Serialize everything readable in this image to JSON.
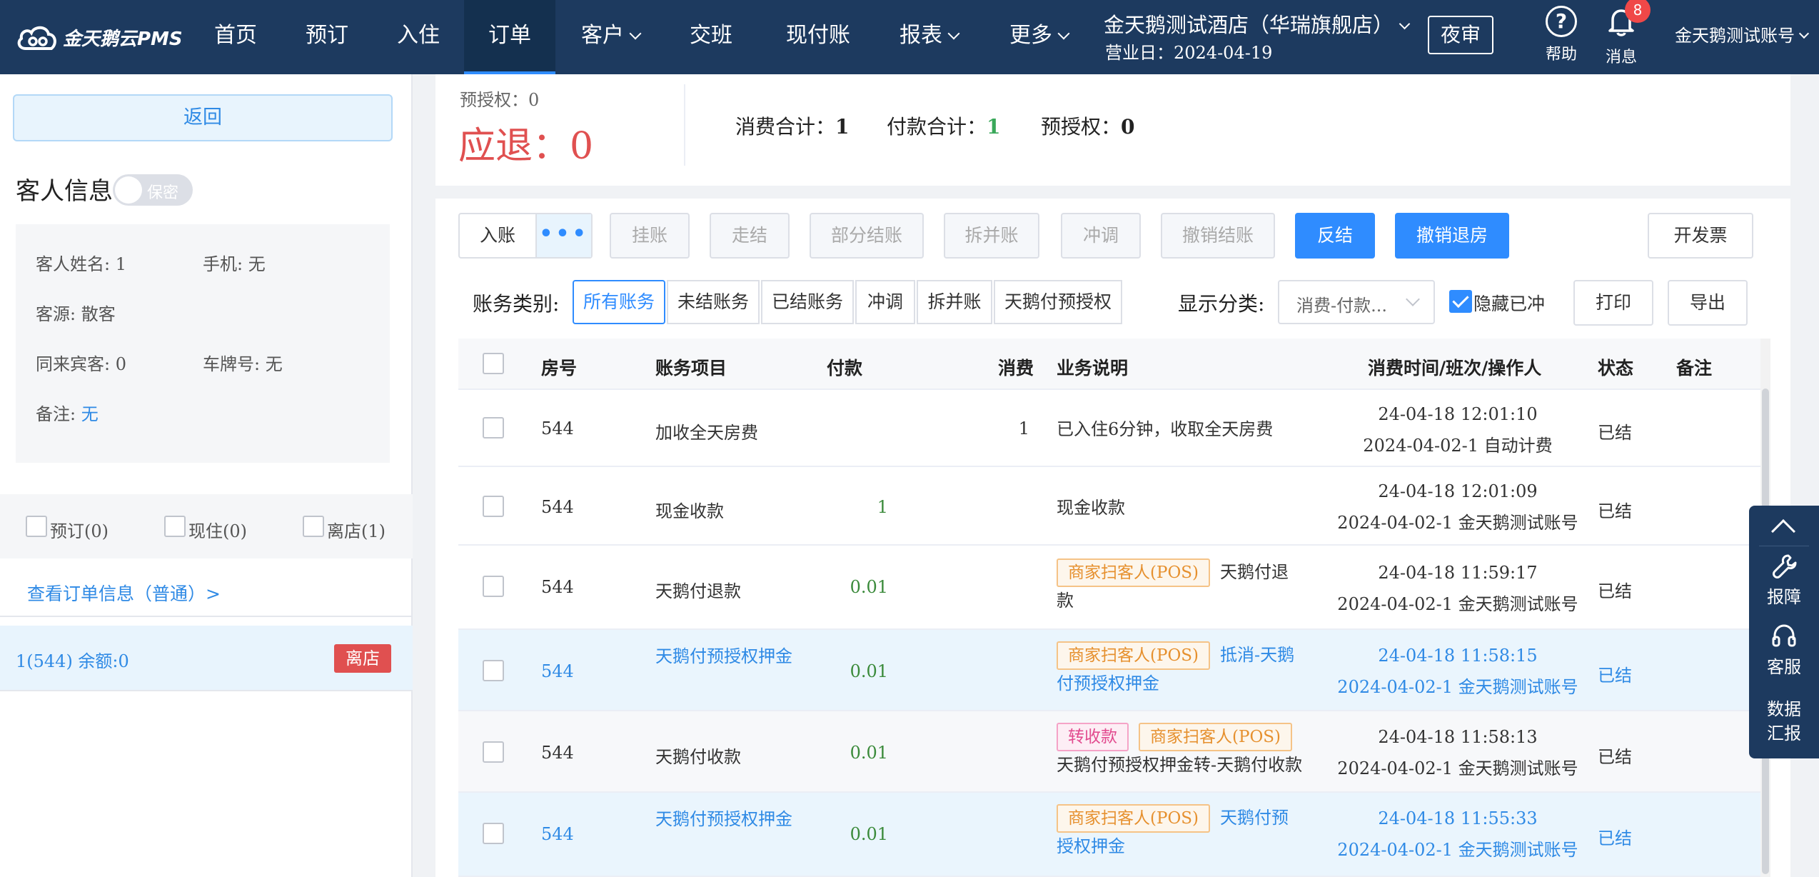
{
  "nav": {
    "logo_text": "金天鹅云PMS",
    "items": [
      {
        "label": "首页",
        "dropdown": false,
        "active": false
      },
      {
        "label": "预订",
        "dropdown": false,
        "active": false
      },
      {
        "label": "入住",
        "dropdown": false,
        "active": false
      },
      {
        "label": "订单",
        "dropdown": false,
        "active": true
      },
      {
        "label": "客户",
        "dropdown": true,
        "active": false
      },
      {
        "label": "交班",
        "dropdown": false,
        "active": false
      },
      {
        "label": "现付账",
        "dropdown": false,
        "active": false
      },
      {
        "label": "报表",
        "dropdown": true,
        "active": false
      },
      {
        "label": "更多",
        "dropdown": true,
        "active": false
      }
    ],
    "hotel_name": "金天鹅测试酒店（华瑞旗舰店）",
    "business_date": "营业日：2024-04-19",
    "night_audit": "夜审",
    "help_label": "帮助",
    "message_label": "消息",
    "message_count": "8",
    "account": "金天鹅测试账号"
  },
  "sidebar": {
    "back": "返回",
    "guest_title": "客人信息",
    "privacy": "保密",
    "guest": {
      "name": "客人姓名: 1",
      "phone": "手机: 无",
      "source": "客源: 散客",
      "companions": "同来宾客: 0",
      "plate": "车牌号: 无",
      "remark_label": "备注: ",
      "remark_value": "无"
    },
    "filters": [
      {
        "label": "预订(0)"
      },
      {
        "label": "现住(0)"
      },
      {
        "label": "离店(1)"
      }
    ],
    "view_order": "查看订单信息（普通）>",
    "room": {
      "text": "1(544)   余额:0",
      "status": "离店"
    }
  },
  "summary": {
    "pre_auth_small": "预授权：0",
    "refund": "应退：0",
    "consume_label": "消费合计：",
    "consume_value": "1",
    "payment_label": "付款合计：",
    "payment_value": "1",
    "pre_auth_label": "预授权：",
    "pre_auth_value": "0"
  },
  "toolbar": {
    "post": "入账",
    "more": "•••",
    "hang": "挂账",
    "walk": "走结",
    "partial": "部分结账",
    "split_merge": "拆并账",
    "adjust": "冲调",
    "cancel_checkout": "撤销结账",
    "reverse": "反结",
    "undo_checkout_room": "撤销退房",
    "invoice": "开发票"
  },
  "filters": {
    "category_label": "账务类别:",
    "tabs": [
      "所有账务",
      "未结账务",
      "已结账务",
      "冲调",
      "拆并账",
      "天鹅付预授权"
    ],
    "display_label": "显示分类:",
    "display_value": "消费-付款...",
    "hide_adjusted": "隐藏已冲调账",
    "print": "打印",
    "export": "导出"
  },
  "table": {
    "headers": {
      "room": "房号",
      "item": "账务项目",
      "payment": "付款",
      "consume": "消费",
      "desc": "业务说明",
      "time": "消费时间/班次/操作人",
      "status": "状态",
      "remark": "备注"
    },
    "rows": [
      {
        "room": "544",
        "item": "加收全天房费",
        "payment": "",
        "consume": "1",
        "tags": [],
        "desc": "已入住6分钟，收取全天房费",
        "time": "24-04-18 12:01:10",
        "shift": "2024-04-02-1 自动计费",
        "status": "已结"
      },
      {
        "room": "544",
        "item": "现金收款",
        "payment": "1",
        "consume": "",
        "tags": [],
        "desc": "现金收款",
        "time": "24-04-18 12:01:09",
        "shift": "2024-04-02-1 金天鹅测试账号",
        "status": "已结"
      },
      {
        "room": "544",
        "item": "天鹅付退款",
        "payment": "0.01",
        "consume": "",
        "tags": [
          "商家扫客人(POS)"
        ],
        "desc": "天鹅付退款",
        "time": "24-04-18 11:59:17",
        "shift": "2024-04-02-1 金天鹅测试账号",
        "status": "已结"
      },
      {
        "room": "544",
        "item": "天鹅付预授权押金",
        "payment": "0.01",
        "consume": "",
        "tags": [
          "商家扫客人(POS)"
        ],
        "desc": "抵消-天鹅付预授权押金",
        "time": "24-04-18 11:58:15",
        "shift": "2024-04-02-1 金天鹅测试账号",
        "status": "已结"
      },
      {
        "room": "544",
        "item": "天鹅付收款",
        "payment": "0.01",
        "consume": "",
        "tags": [
          "转收款",
          "商家扫客人(POS)"
        ],
        "desc": "天鹅付预授权押金转-天鹅付收款",
        "time": "24-04-18 11:58:13",
        "shift": "2024-04-02-1 金天鹅测试账号",
        "status": "已结"
      },
      {
        "room": "544",
        "item": "天鹅付预授权押金",
        "payment": "0.01",
        "consume": "",
        "tags": [
          "商家扫客人(POS)"
        ],
        "desc": "天鹅付预授权押金",
        "time": "24-04-18 11:55:33",
        "shift": "2024-04-02-1 金天鹅测试账号",
        "status": "已结"
      }
    ]
  },
  "float_panel": {
    "report_issue": "报障",
    "service": "客服",
    "data_report_1": "数据",
    "data_report_2": "汇报"
  },
  "colors": {
    "nav_bg": "#1d3a5f",
    "primary": "#2f8cff",
    "danger": "#e05050",
    "pos_tag": "#e6902e",
    "transfer_tag": "#e24b8f"
  }
}
